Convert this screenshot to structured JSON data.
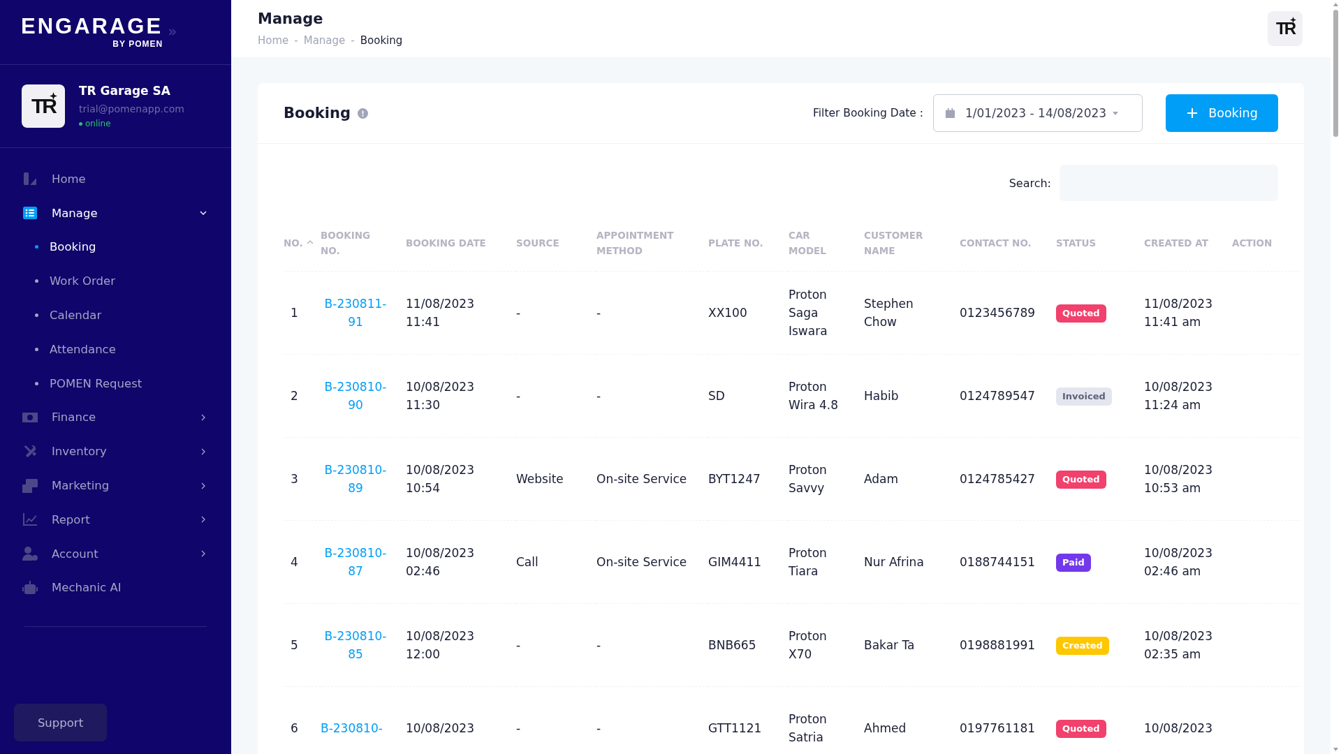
{
  "sidebar": {
    "logo": {
      "title": "ENGARAGE",
      "subtitle": "BY POMEN"
    },
    "profile": {
      "avatar_text": "TR",
      "name": "TR Garage SA",
      "email": "trial@pomenapp.com",
      "status": "online",
      "online": true
    },
    "items": [
      {
        "label": "Home",
        "selected": false
      },
      {
        "label": "Manage",
        "selected": true,
        "expanded": true,
        "children": [
          {
            "label": "Booking",
            "selected": true
          },
          {
            "label": "Work Order",
            "selected": false
          },
          {
            "label": "Calendar",
            "selected": false
          },
          {
            "label": "Attendance",
            "selected": false
          },
          {
            "label": "POMEN Request",
            "selected": false
          }
        ]
      },
      {
        "label": "Finance",
        "selected": false,
        "expanded": false
      },
      {
        "label": "Inventory",
        "selected": false,
        "expanded": false
      },
      {
        "label": "Marketing",
        "selected": false,
        "expanded": false
      },
      {
        "label": "Report",
        "selected": false,
        "expanded": false
      },
      {
        "label": "Account",
        "selected": false,
        "expanded": false
      },
      {
        "label": "Mechanic AI",
        "selected": false
      }
    ],
    "support_button": "Support"
  },
  "header": {
    "title": "Manage",
    "breadcrumb_separator": "-",
    "breadcrumb": [
      {
        "label": "Home",
        "current": false
      },
      {
        "label": "Manage",
        "current": false
      },
      {
        "label": "Booking",
        "current": true
      }
    ],
    "avatar_text": "TR"
  },
  "card": {
    "title": "Booking",
    "filter_label": "Filter Booking Date :",
    "date_range": "1/01/2023 - 14/08/2023",
    "add_button": "Booking",
    "search_label": "Search:"
  },
  "table": {
    "columns": [
      {
        "label": "NO.",
        "sorted": true
      },
      {
        "label": "BOOKING NO.",
        "sorted": false
      },
      {
        "label": "BOOKING DATE",
        "sorted": false
      },
      {
        "label": "SOURCE",
        "sorted": false
      },
      {
        "label": "APPOINTMENT METHOD",
        "sorted": false
      },
      {
        "label": "PLATE NO.",
        "sorted": false
      },
      {
        "label": "CAR MODEL",
        "sorted": false
      },
      {
        "label": "CUSTOMER NAME",
        "sorted": false
      },
      {
        "label": "CONTACT NO.",
        "sorted": false
      },
      {
        "label": "STATUS",
        "sorted": false
      },
      {
        "label": "CREATED AT",
        "sorted": false
      },
      {
        "label": "ACTION",
        "sorted": false
      }
    ],
    "rows": [
      {
        "no": "1",
        "booking_no": "B-230811-91",
        "booking_date": "11/08/2023 11:41",
        "source": "-",
        "appointment_method": "-",
        "plate_no": "XX100",
        "car_model": "Proton Saga Iswara",
        "customer_name": "Stephen Chow",
        "contact_no": "0123456789",
        "status": {
          "label": "Quoted",
          "color": "#f1416c"
        },
        "created_at": "11/08/2023 11:41 am"
      },
      {
        "no": "2",
        "booking_no": "B-230810-90",
        "booking_date": "10/08/2023 11:30",
        "source": "-",
        "appointment_method": "-",
        "plate_no": "SD",
        "car_model": "Proton Wira 4.8",
        "customer_name": "Habib",
        "contact_no": "0124789547",
        "status": {
          "label": "Invoiced",
          "color": "#e4e6ef"
        },
        "created_at": "10/08/2023 11:24 am"
      },
      {
        "no": "3",
        "booking_no": "B-230810-89",
        "booking_date": "10/08/2023 10:54",
        "source": "Website",
        "appointment_method": "On-site Service",
        "plate_no": "BYT1247",
        "car_model": "Proton Savvy",
        "customer_name": "Adam",
        "contact_no": "0124785427",
        "status": {
          "label": "Quoted",
          "color": "#f1416c"
        },
        "created_at": "10/08/2023 10:53 am"
      },
      {
        "no": "4",
        "booking_no": "B-230810-87",
        "booking_date": "10/08/2023 02:46",
        "source": "Call",
        "appointment_method": "On-site Service",
        "plate_no": "GIM4411",
        "car_model": "Proton Tiara",
        "customer_name": "Nur Afrina",
        "contact_no": "0188744151",
        "status": {
          "label": "Paid",
          "color": "#7239ea"
        },
        "created_at": "10/08/2023 02:46 am"
      },
      {
        "no": "5",
        "booking_no": "B-230810-85",
        "booking_date": "10/08/2023 12:00",
        "source": "-",
        "appointment_method": "-",
        "plate_no": "BNB665",
        "car_model": "Proton X70",
        "customer_name": "Bakar Ta",
        "contact_no": "0198881991",
        "status": {
          "label": "Created",
          "color": "#ffc700"
        },
        "created_at": "10/08/2023 02:35 am"
      },
      {
        "no": "6",
        "booking_no": "B-230810-",
        "booking_date": "10/08/2023",
        "source": "-",
        "appointment_method": "-",
        "plate_no": "GTT1121",
        "car_model": "Proton Satria",
        "customer_name": "Ahmed",
        "contact_no": "0197761181",
        "status": {
          "label": "Quoted",
          "color": "#f1416c"
        },
        "created_at": "10/08/2023"
      }
    ]
  }
}
